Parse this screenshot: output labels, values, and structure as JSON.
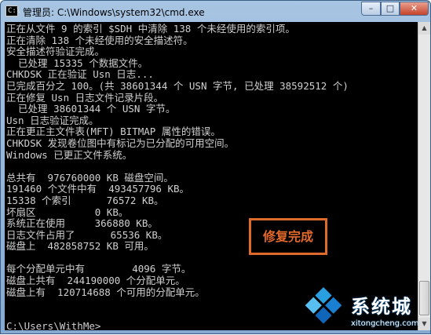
{
  "window": {
    "title": "管理员: C:\\Windows\\system32\\cmd.exe",
    "icon_text": "C:\\"
  },
  "controls": {
    "minimize": "–",
    "maximize": "□",
    "close": "✕"
  },
  "console_lines": [
    "正在从文件 9 的索引 $SDH 中清除 138 个未经使用的索引项。",
    "正在清除 138 个未经使用的安全描述符。",
    "安全描述符验证完成。",
    "  已处理 15335 个数据文件。",
    "CHKDSK 正在验证 Usn 日志...",
    "已完成百分之 100。(共 38601344 个 USN 字节, 已处理 38592512 个)",
    "正在修复 Usn 日志文件记录片段。",
    "  已处理 38601344 个 USN 字节。",
    "Usn 日志验证完成。",
    "正在更正主文件表(MFT) BITMAP 属性的错误。",
    "CHKDSK 发现卷位图中有标记为已分配的可用空间。",
    "Windows 已更正文件系统。",
    "",
    "总共有  976760000 KB 磁盘空间。",
    "191460 个文件中有  493457796 KB。",
    "15338 个索引      76572 KB。",
    "坏扇区          0 KB。",
    "系统正在使用     366880 KB。",
    "日志文件占用了      65536 KB。",
    "磁盘上  482858752 KB 可用。",
    "",
    "每个分配单元中有        4096 字节。",
    "磁盘上共有  244190000 个分配单元。",
    "磁盘上有  120714688 个可用的分配单元。",
    "",
    "",
    "C:\\Users\\WithMe>"
  ],
  "annotation": "修复完成",
  "watermark": {
    "brand": "系统城",
    "url": "xitongcheng.com"
  },
  "colors": {
    "console_bg": "#000000",
    "console_text": "#d0d0d0",
    "annotation": "#e2692a"
  }
}
